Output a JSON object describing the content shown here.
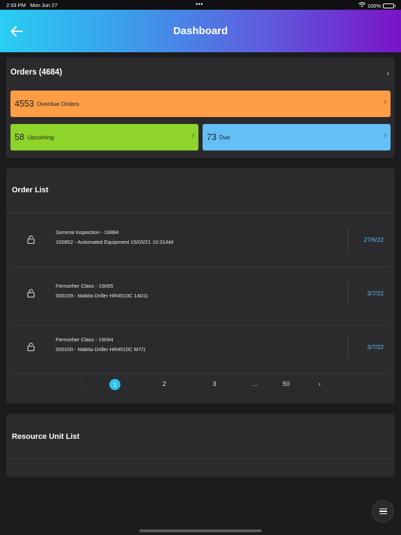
{
  "status_bar": {
    "time": "2:33 PM",
    "date": "Mon Jun 27",
    "dots": "•••",
    "battery": "100%"
  },
  "header": {
    "title": "Dashboard",
    "back_icon": "arrow-left-icon"
  },
  "orders": {
    "title": "Orders (4684)",
    "tiles": [
      {
        "count": "4553",
        "label": "Overdue Orders",
        "color": "#fd9e46"
      },
      {
        "count": "58",
        "label": "Upcoming",
        "color": "#8fd42a"
      },
      {
        "count": "73",
        "label": "Due",
        "color": "#64bff7"
      }
    ]
  },
  "order_list": {
    "title": "Order List",
    "rows": [
      {
        "line1": "General Inspection - 16884",
        "line2": "100852 - Automated Equipment 15/03/21 10:31AM",
        "date": "27/6/22"
      },
      {
        "line1": "Fernseher Class - 16065",
        "line2": "500109 - Makita Driller HR4510C 14011",
        "date": "3/7/22"
      },
      {
        "line1": "Fernseher Class - 16064",
        "line2": "500100 - Makita Driller HR4510C M7/1",
        "date": "3/7/22"
      }
    ],
    "pagination": {
      "prev": "‹",
      "pages": [
        "1",
        "2",
        "3",
        "...",
        "50"
      ],
      "next": "›",
      "current": "1"
    }
  },
  "resource_unit_list": {
    "title": "Resource Unit List"
  },
  "colors": {
    "accent": "#2ec2ee",
    "date_text": "#59bff5",
    "card_bg": "#2b2b2e",
    "page_bg": "#1c1c1e"
  }
}
